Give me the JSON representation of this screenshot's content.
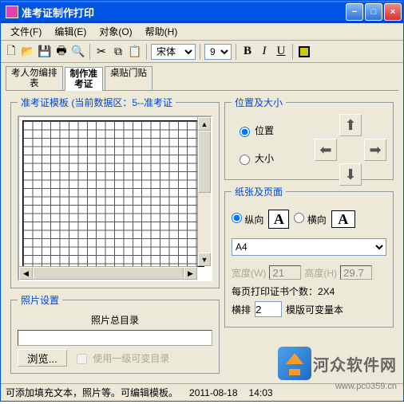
{
  "window": {
    "title": "准考证制作打印"
  },
  "menu": {
    "file": "文件(F)",
    "edit": "编辑(E)",
    "object": "对象(O)",
    "help": "帮助(H)"
  },
  "toolbar": {
    "font": "宋体",
    "size": "9"
  },
  "tabs": {
    "t1": "考人勿编排\n表",
    "t2": "制作准\n考证",
    "t3": "桌贴门贴"
  },
  "template": {
    "legend": "准考证模板 (当前数据区：5--准考证"
  },
  "photo": {
    "legend": "照片设置",
    "dir_label": "照片总目录",
    "browse": "浏览...",
    "use_var": "使用一级可变目录"
  },
  "pos": {
    "legend": "位置及大小",
    "position": "位置",
    "size": "大小"
  },
  "paper": {
    "legend": "纸张及页面",
    "portrait": "纵向",
    "landscape": "横向",
    "size": "A4",
    "width_label": "宽度(W)",
    "width_val": "21",
    "height_label": "高度(H)",
    "height_val": "29.7",
    "per_page": "每页打印证书个数：2X4",
    "hpai": "横排",
    "hpai_val": "2",
    "template_var": "模版可变量本"
  },
  "status": {
    "msg": "可添加填充文本，照片等。可编辑模板。",
    "date": "2011-08-18",
    "time": "14:03"
  },
  "watermark": {
    "text": "河众软件网",
    "url": "www.pc0359.cn"
  }
}
